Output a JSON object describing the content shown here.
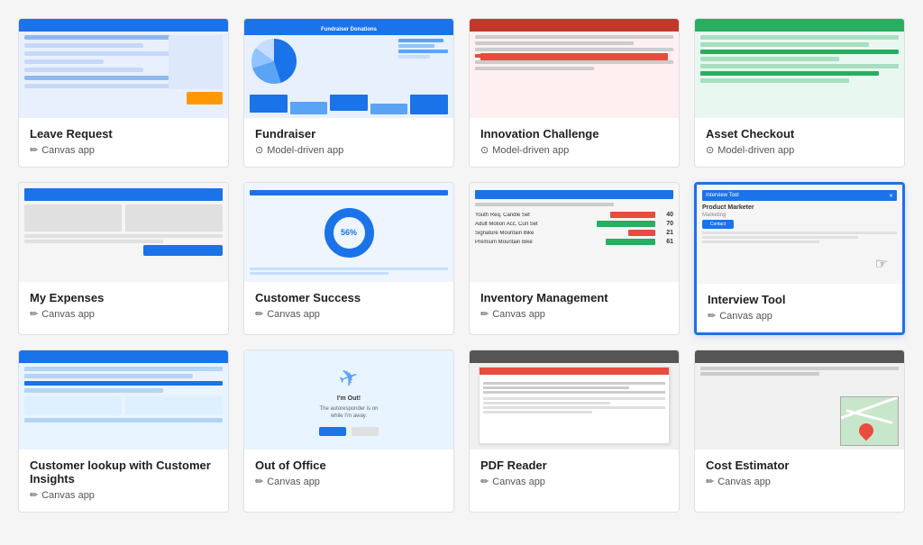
{
  "cards": [
    {
      "id": "leave-request",
      "title": "Leave Request",
      "type": "Canvas app",
      "typeIcon": "pencil",
      "selected": false,
      "thumbnail": "leave"
    },
    {
      "id": "fundraiser",
      "title": "Fundraiser",
      "type": "Model-driven app",
      "typeIcon": "model",
      "selected": false,
      "thumbnail": "fundraiser"
    },
    {
      "id": "innovation-challenge",
      "title": "Innovation Challenge",
      "type": "Model-driven app",
      "typeIcon": "model",
      "selected": false,
      "thumbnail": "innovation"
    },
    {
      "id": "asset-checkout",
      "title": "Asset Checkout",
      "type": "Model-driven app",
      "typeIcon": "model",
      "selected": false,
      "thumbnail": "asset"
    },
    {
      "id": "my-expenses",
      "title": "My Expenses",
      "type": "Canvas app",
      "typeIcon": "pencil",
      "selected": false,
      "thumbnail": "expenses"
    },
    {
      "id": "customer-success",
      "title": "Customer Success",
      "type": "Canvas app",
      "typeIcon": "pencil",
      "selected": false,
      "thumbnail": "customer-success"
    },
    {
      "id": "inventory-management",
      "title": "Inventory Management",
      "type": "Canvas app",
      "typeIcon": "pencil",
      "selected": false,
      "thumbnail": "inventory"
    },
    {
      "id": "interview-tool",
      "title": "Interview Tool",
      "type": "Canvas app",
      "typeIcon": "pencil",
      "selected": true,
      "thumbnail": "interview"
    },
    {
      "id": "customer-lookup",
      "title": "Customer lookup with Customer Insights",
      "type": "Canvas app",
      "typeIcon": "pencil",
      "selected": false,
      "thumbnail": "customer-lookup"
    },
    {
      "id": "out-of-office",
      "title": "Out of Office",
      "type": "Canvas app",
      "typeIcon": "pencil",
      "selected": false,
      "thumbnail": "ooo"
    },
    {
      "id": "pdf-reader",
      "title": "PDF Reader",
      "type": "Canvas app",
      "typeIcon": "pencil",
      "selected": false,
      "thumbnail": "pdf"
    },
    {
      "id": "cost-estimator",
      "title": "Cost Estimator",
      "type": "Canvas app",
      "typeIcon": "pencil",
      "selected": false,
      "thumbnail": "cost"
    }
  ],
  "icons": {
    "pencil": "✏",
    "model": "⊙"
  }
}
